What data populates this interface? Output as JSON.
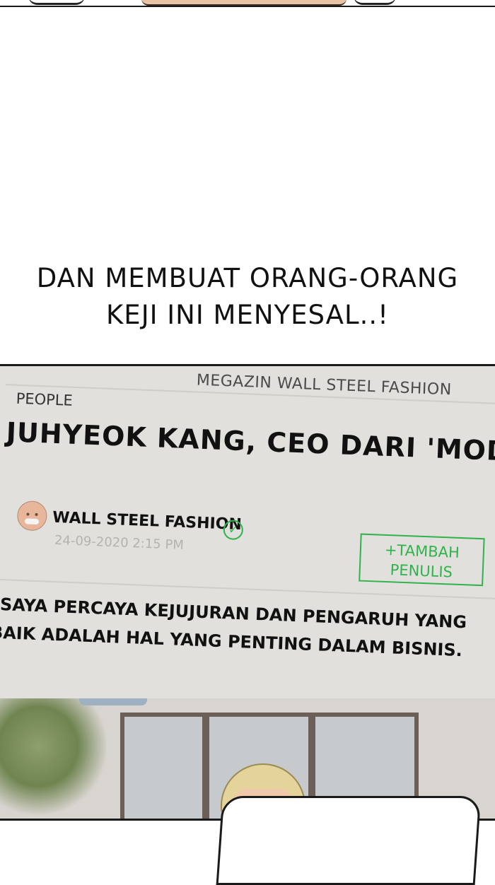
{
  "narration": {
    "line1": "DAN MEMBUAT ORANG-ORANG",
    "line2": "KEJI INI MENYESAL..!"
  },
  "article": {
    "magazine_title": "MEGAZIN WALL STEEL FASHION",
    "category": "PEOPLE",
    "headline": "JUHYEOK KANG, CEO DARI 'MOD",
    "author_name": "WALL STEEL FASHION",
    "verified_icon": "check-circle-icon",
    "date": "24-09-2020  2:15 PM",
    "follow_button_line1": "+TAMBAH",
    "follow_button_line2": "PENULIS",
    "quote_line1": "\"SAYA PERCAYA KEJUJURAN DAN PENGARUH YANG",
    "quote_line2": "BAIK ADALAH HAL YANG PENTING DALAM BISNIS.",
    "accent_color": "#2fb34a"
  }
}
